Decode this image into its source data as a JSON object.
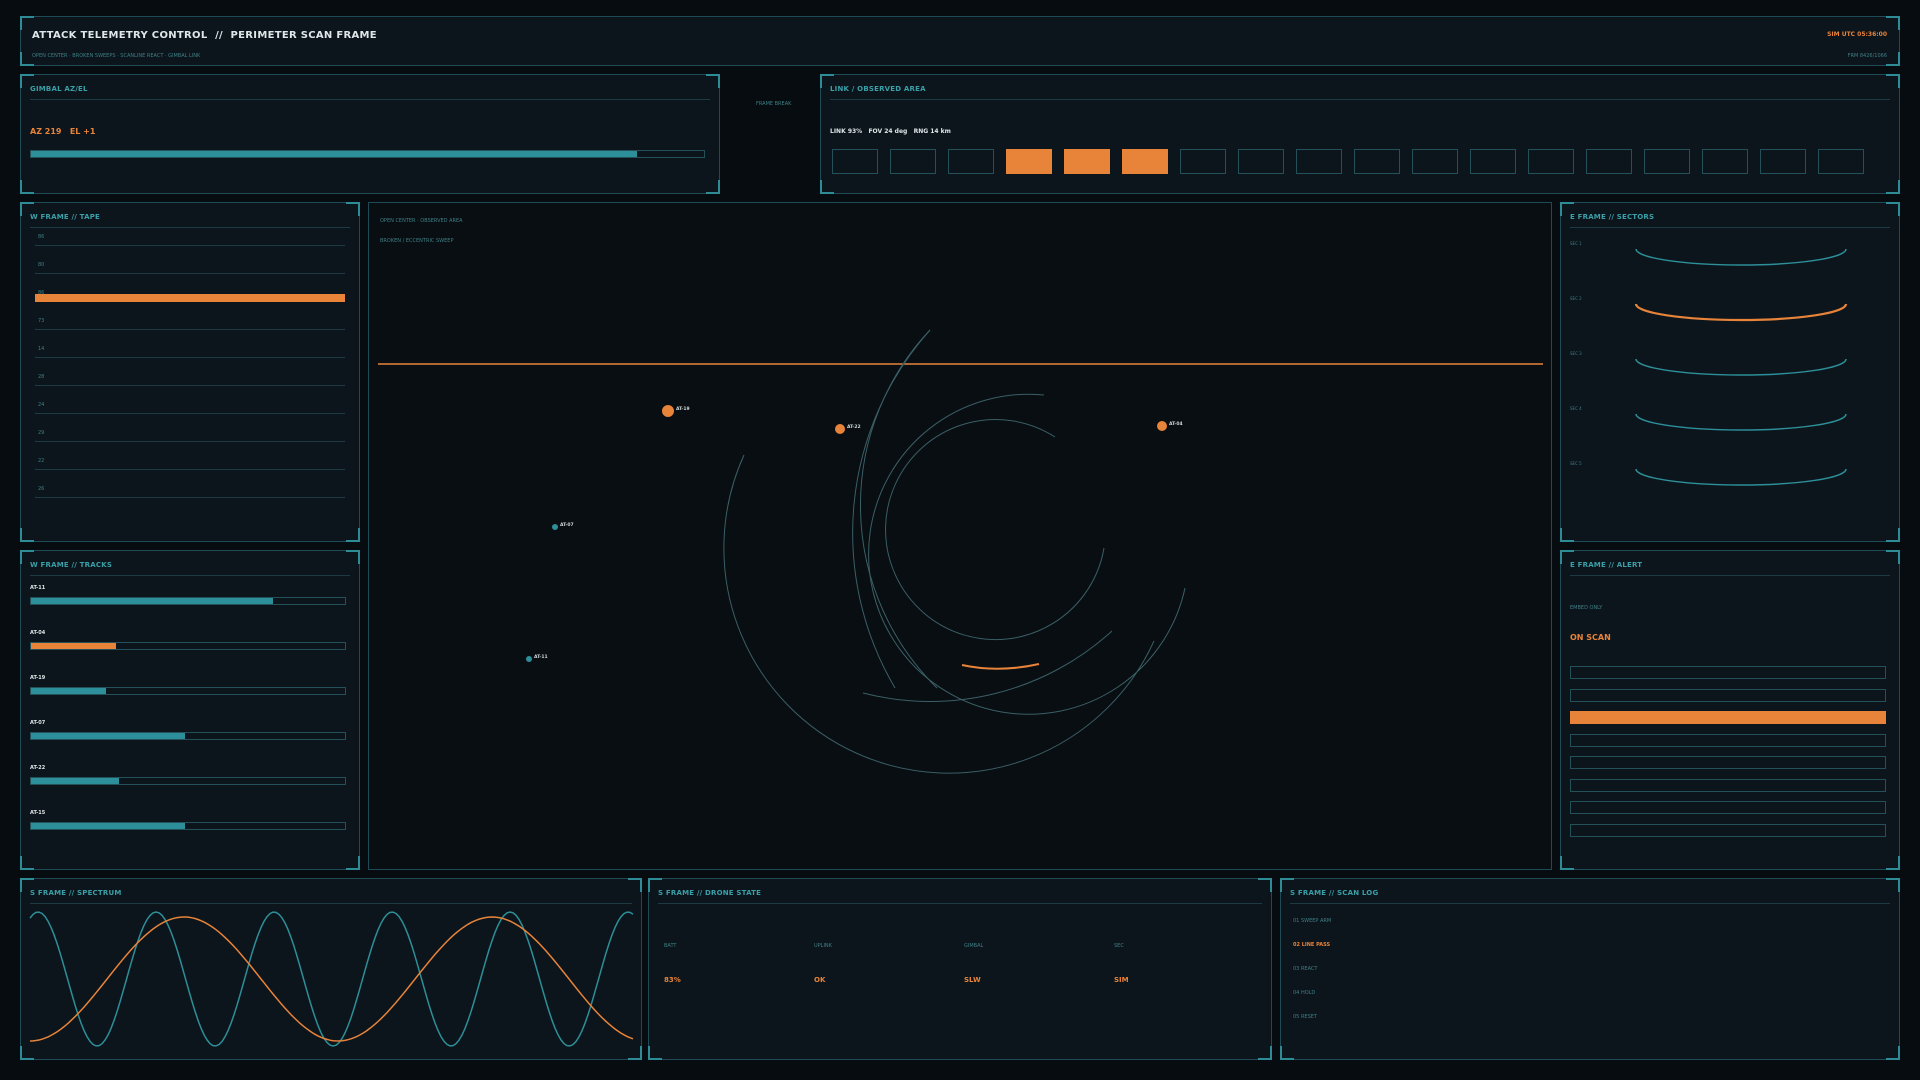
{
  "header": {
    "title": "ATTACK TELEMETRY CONTROL  //  PERIMETER SCAN FRAME",
    "subtitle": "OPEN CENTER · BROKEN SWEEPS · SCANLINE REACT · GIMBAL LINK",
    "clock": "SIM UTC 05:36:00",
    "frame": "FRM 8426/1066"
  },
  "gimbal": {
    "title": "GIMBAL AZ/EL",
    "readout": "AZ 219   EL +1",
    "fill": 0.9
  },
  "frame_break": "FRAME BREAK",
  "link": {
    "title": "LINK / OBSERVED AREA",
    "readout": "LINK 93%   FOV 24 deg   RNG 14 km",
    "cells": [
      false,
      false,
      false,
      true,
      true,
      true,
      false,
      false,
      false,
      false,
      false,
      false,
      false,
      false,
      false,
      false,
      false,
      false
    ]
  },
  "tape": {
    "title": "W FRAME  //  TAPE",
    "ticks": [
      "86",
      "80",
      "86",
      "73",
      "14",
      "28",
      "24",
      "29",
      "22",
      "26"
    ],
    "highlight_fill": 1.0
  },
  "center": {
    "line1": "OPEN CENTER · OBSERVED AREA",
    "line2": "BROKEN / ECCENTRIC SWEEP",
    "targets": [
      {
        "id": "AT-19",
        "color": "orange",
        "r": 6
      },
      {
        "id": "AT-22",
        "color": "orange",
        "r": 5
      },
      {
        "id": "AT-04",
        "color": "orange",
        "r": 5
      },
      {
        "id": "AT-07",
        "color": "teal",
        "r": 3
      },
      {
        "id": "AT-11",
        "color": "teal",
        "r": 3
      }
    ]
  },
  "tracks": {
    "title": "W FRAME  //  TRACKS",
    "items": [
      {
        "label": "AT-11",
        "fill": 0.77,
        "color": "teal"
      },
      {
        "label": "AT-04",
        "fill": 0.27,
        "color": "orange"
      },
      {
        "label": "AT-19",
        "fill": 0.24,
        "color": "teal"
      },
      {
        "label": "AT-07",
        "fill": 0.49,
        "color": "teal"
      },
      {
        "label": "AT-22",
        "fill": 0.28,
        "color": "teal"
      },
      {
        "label": "AT-15",
        "fill": 0.49,
        "color": "teal"
      }
    ]
  },
  "sectors": {
    "title": "E FRAME  //  SECTORS",
    "items": [
      {
        "label": "SEC 1",
        "active": false
      },
      {
        "label": "SEC 2",
        "active": true
      },
      {
        "label": "SEC 3",
        "active": false
      },
      {
        "label": "SEC 4",
        "active": false
      },
      {
        "label": "SEC 5",
        "active": false
      }
    ]
  },
  "alert": {
    "title": "E FRAME  //  ALERT",
    "mode": "EMBED ONLY",
    "status": "ON SCAN",
    "rows": [
      false,
      false,
      true,
      false,
      false,
      false,
      false,
      false
    ]
  },
  "spectrum": {
    "title": "S FRAME  //  SPECTRUM"
  },
  "drone": {
    "title": "S FRAME  //  DRONE STATE",
    "items": [
      {
        "label": "BATT",
        "value": "83%"
      },
      {
        "label": "UPLINK",
        "value": "OK"
      },
      {
        "label": "GIMBAL",
        "value": "SLW"
      },
      {
        "label": "SEC",
        "value": "SIM"
      }
    ]
  },
  "scanlog": {
    "title": "S FRAME  //  SCAN LOG",
    "items": [
      {
        "text": "01 SWEEP ARM",
        "active": false
      },
      {
        "text": "02 LINE PASS",
        "active": true
      },
      {
        "text": "03 REACT",
        "active": false
      },
      {
        "text": "04 HOLD",
        "active": false
      },
      {
        "text": "05 RESET",
        "active": false
      }
    ]
  },
  "colors": {
    "teal": "#2d8f99",
    "orange": "#e8833a",
    "bg": "#0c151b"
  }
}
